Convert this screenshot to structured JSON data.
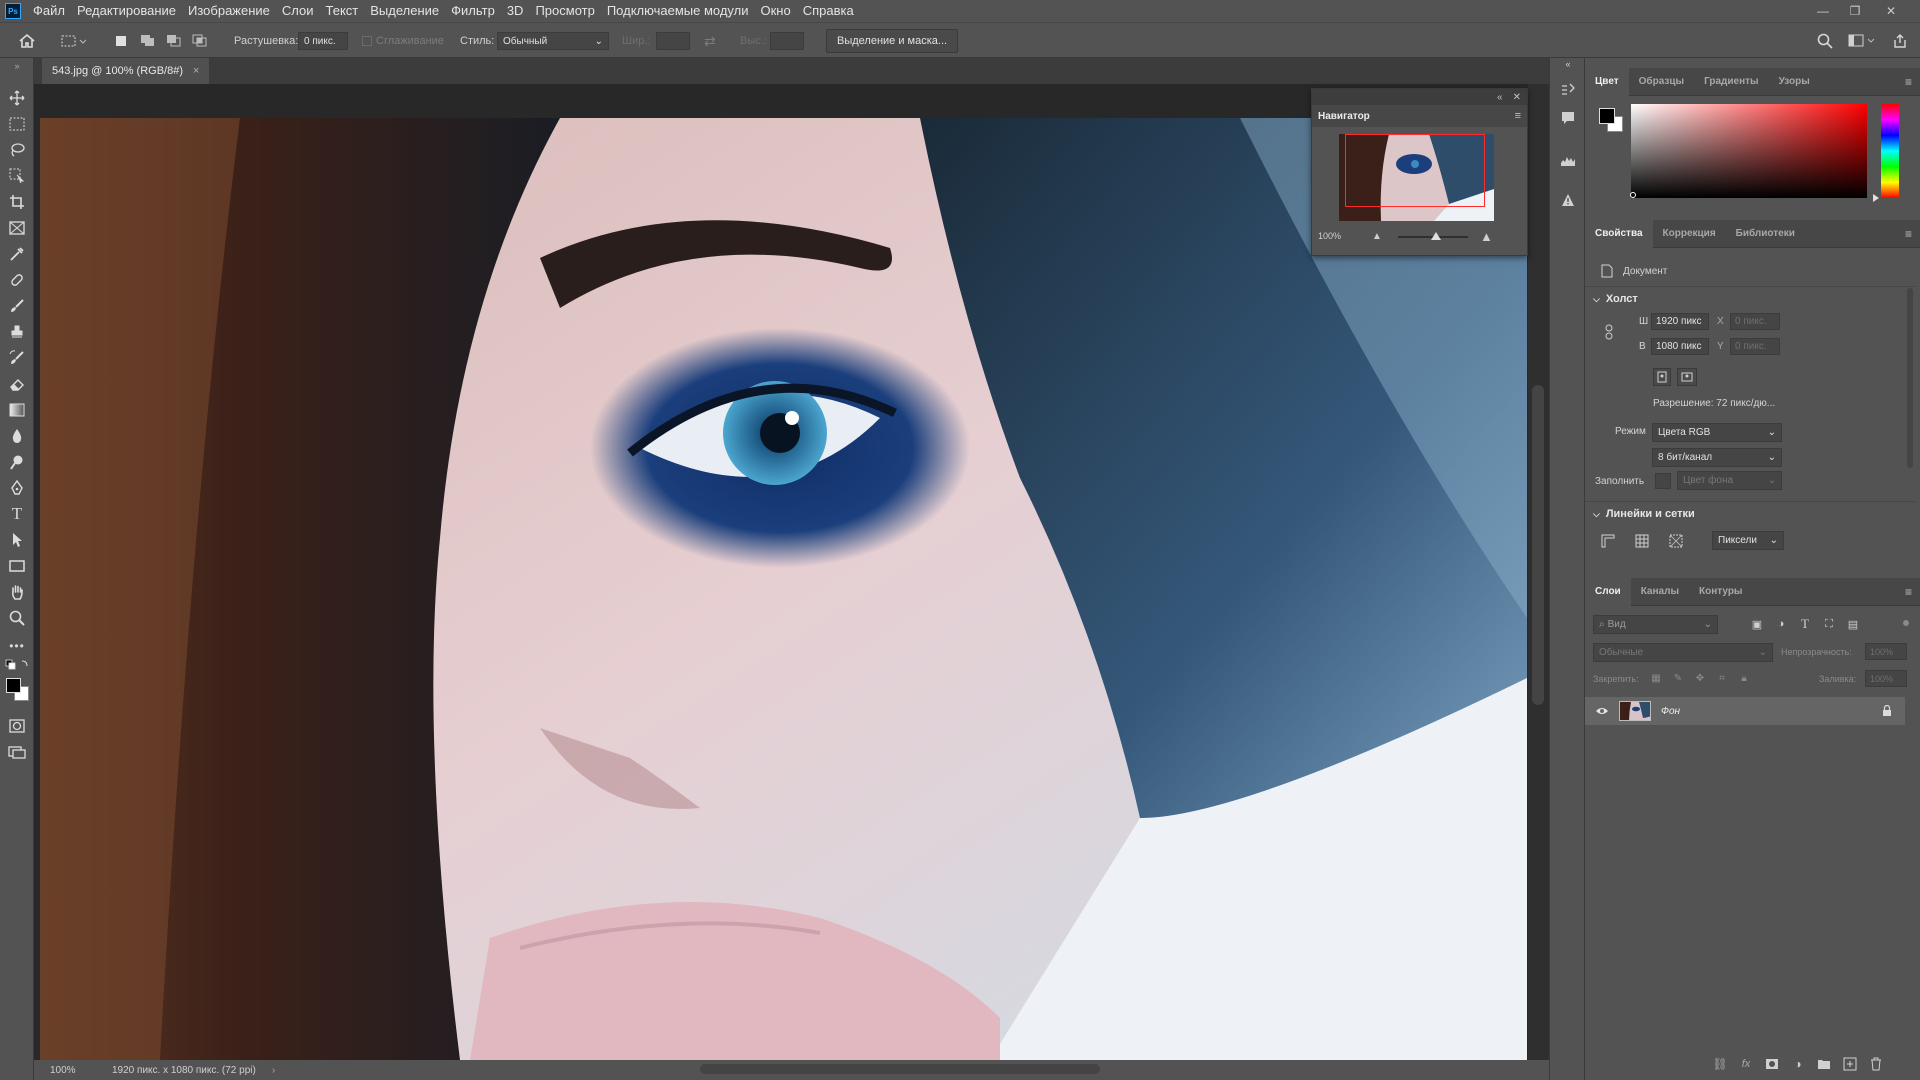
{
  "app": {
    "logo": "Ps"
  },
  "menu": [
    "Файл",
    "Редактирование",
    "Изображение",
    "Слои",
    "Текст",
    "Выделение",
    "Фильтр",
    "3D",
    "Просмотр",
    "Подключаемые модули",
    "Окно",
    "Справка"
  ],
  "window_controls": {
    "minimize": "—",
    "restore": "❐",
    "close": "✕"
  },
  "options": {
    "feather_label": "Растушевка:",
    "feather_value": "0 пикс.",
    "antialias_label": "Сглаживание",
    "style_label": "Стиль:",
    "style_value": "Обычный",
    "width_label": "Шир.:",
    "height_label": "Выс.:",
    "select_mask_button": "Выделение и маска..."
  },
  "document": {
    "tab_title": "543.jpg @ 100% (RGB/8#)",
    "tab_close": "×"
  },
  "navigator": {
    "title": "Навигатор",
    "zoom": "100%"
  },
  "color_panel": {
    "tabs": [
      "Цвет",
      "Образцы",
      "Градиенты",
      "Узоры"
    ],
    "foreground": "#000000",
    "background": "#ffffff",
    "hue_base": "#ff0000"
  },
  "properties": {
    "tabs": [
      "Свойства",
      "Коррекция",
      "Библиотеки"
    ],
    "doc_label": "Документ",
    "canvas_section": "Холст",
    "w_label": "Ш",
    "w_value": "1920 пикс",
    "h_label": "В",
    "h_value": "1080 пикс",
    "x_label": "X",
    "x_value": "0 пикс.",
    "y_label": "Y",
    "y_value": "0 пикс.",
    "resolution": "Разрешение: 72 пикс/дю...",
    "mode_label": "Режим",
    "mode_value": "Цвета RGB",
    "depth_value": "8 бит/канал",
    "fill_label": "Заполнить",
    "fill_value": "Цвет фона",
    "rulers_section": "Линейки и сетки",
    "units_value": "Пиксели"
  },
  "layers": {
    "tabs": [
      "Слои",
      "Каналы",
      "Контуры"
    ],
    "search_placeholder": "Вид",
    "blend_mode": "Обычные",
    "opacity_label": "Непрозрачность:",
    "opacity_value": "100%",
    "lock_label": "Закрепить:",
    "fill_label": "Заливка:",
    "fill_value": "100%",
    "items": [
      {
        "name": "Фон",
        "visible": true,
        "locked": true
      }
    ]
  },
  "status": {
    "zoom": "100%",
    "doc_info": "1920 пикс. x 1080 пикс. (72 ppi)"
  }
}
